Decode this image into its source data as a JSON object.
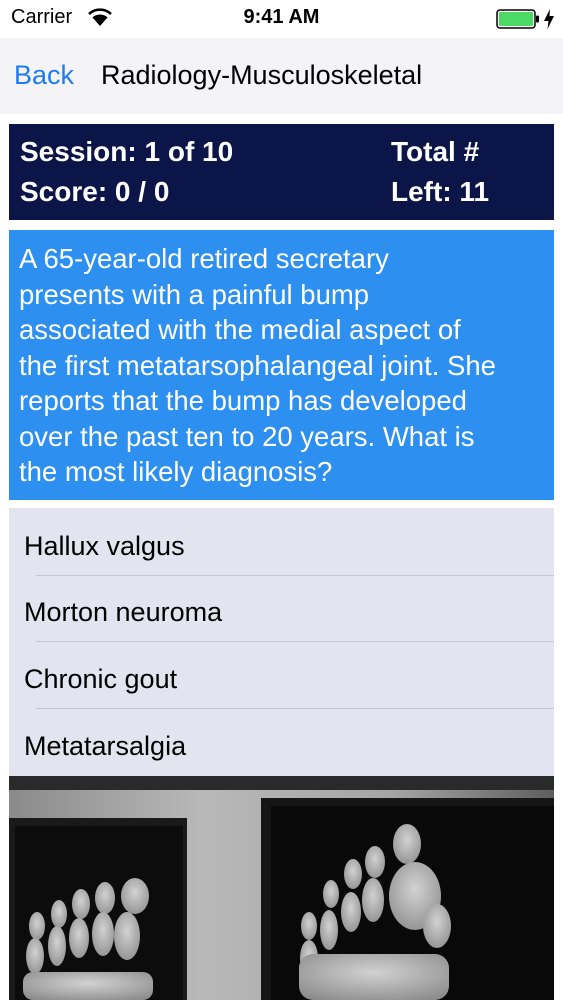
{
  "status_bar": {
    "carrier": "Carrier",
    "time": "9:41 AM",
    "battery_color": "#4cd964"
  },
  "nav": {
    "back_label": "Back",
    "title": "Radiology-Musculoskeletal",
    "accent_color": "#1e7bf2"
  },
  "session": {
    "session_label": "Session: 1 of 10",
    "score_label": "Score: 0 / 0",
    "total_label": "Total #",
    "left_label": "Left: 11",
    "bg_color": "#0c1547"
  },
  "question": {
    "lines": [
      "A 65-year-old retired secretary",
      "presents with a painful bump",
      "associated with the medial aspect of",
      "the first metatarsophalangeal joint. She",
      "reports that the bump has developed",
      "over the past ten to 20 years. What is",
      "the most likely diagnosis?"
    ],
    "bg_color": "#2d8ff0"
  },
  "answers": [
    {
      "label": "Hallux valgus"
    },
    {
      "label": "Morton neuroma"
    },
    {
      "label": "Chronic gout"
    },
    {
      "label": "Metatarsalgia"
    }
  ]
}
